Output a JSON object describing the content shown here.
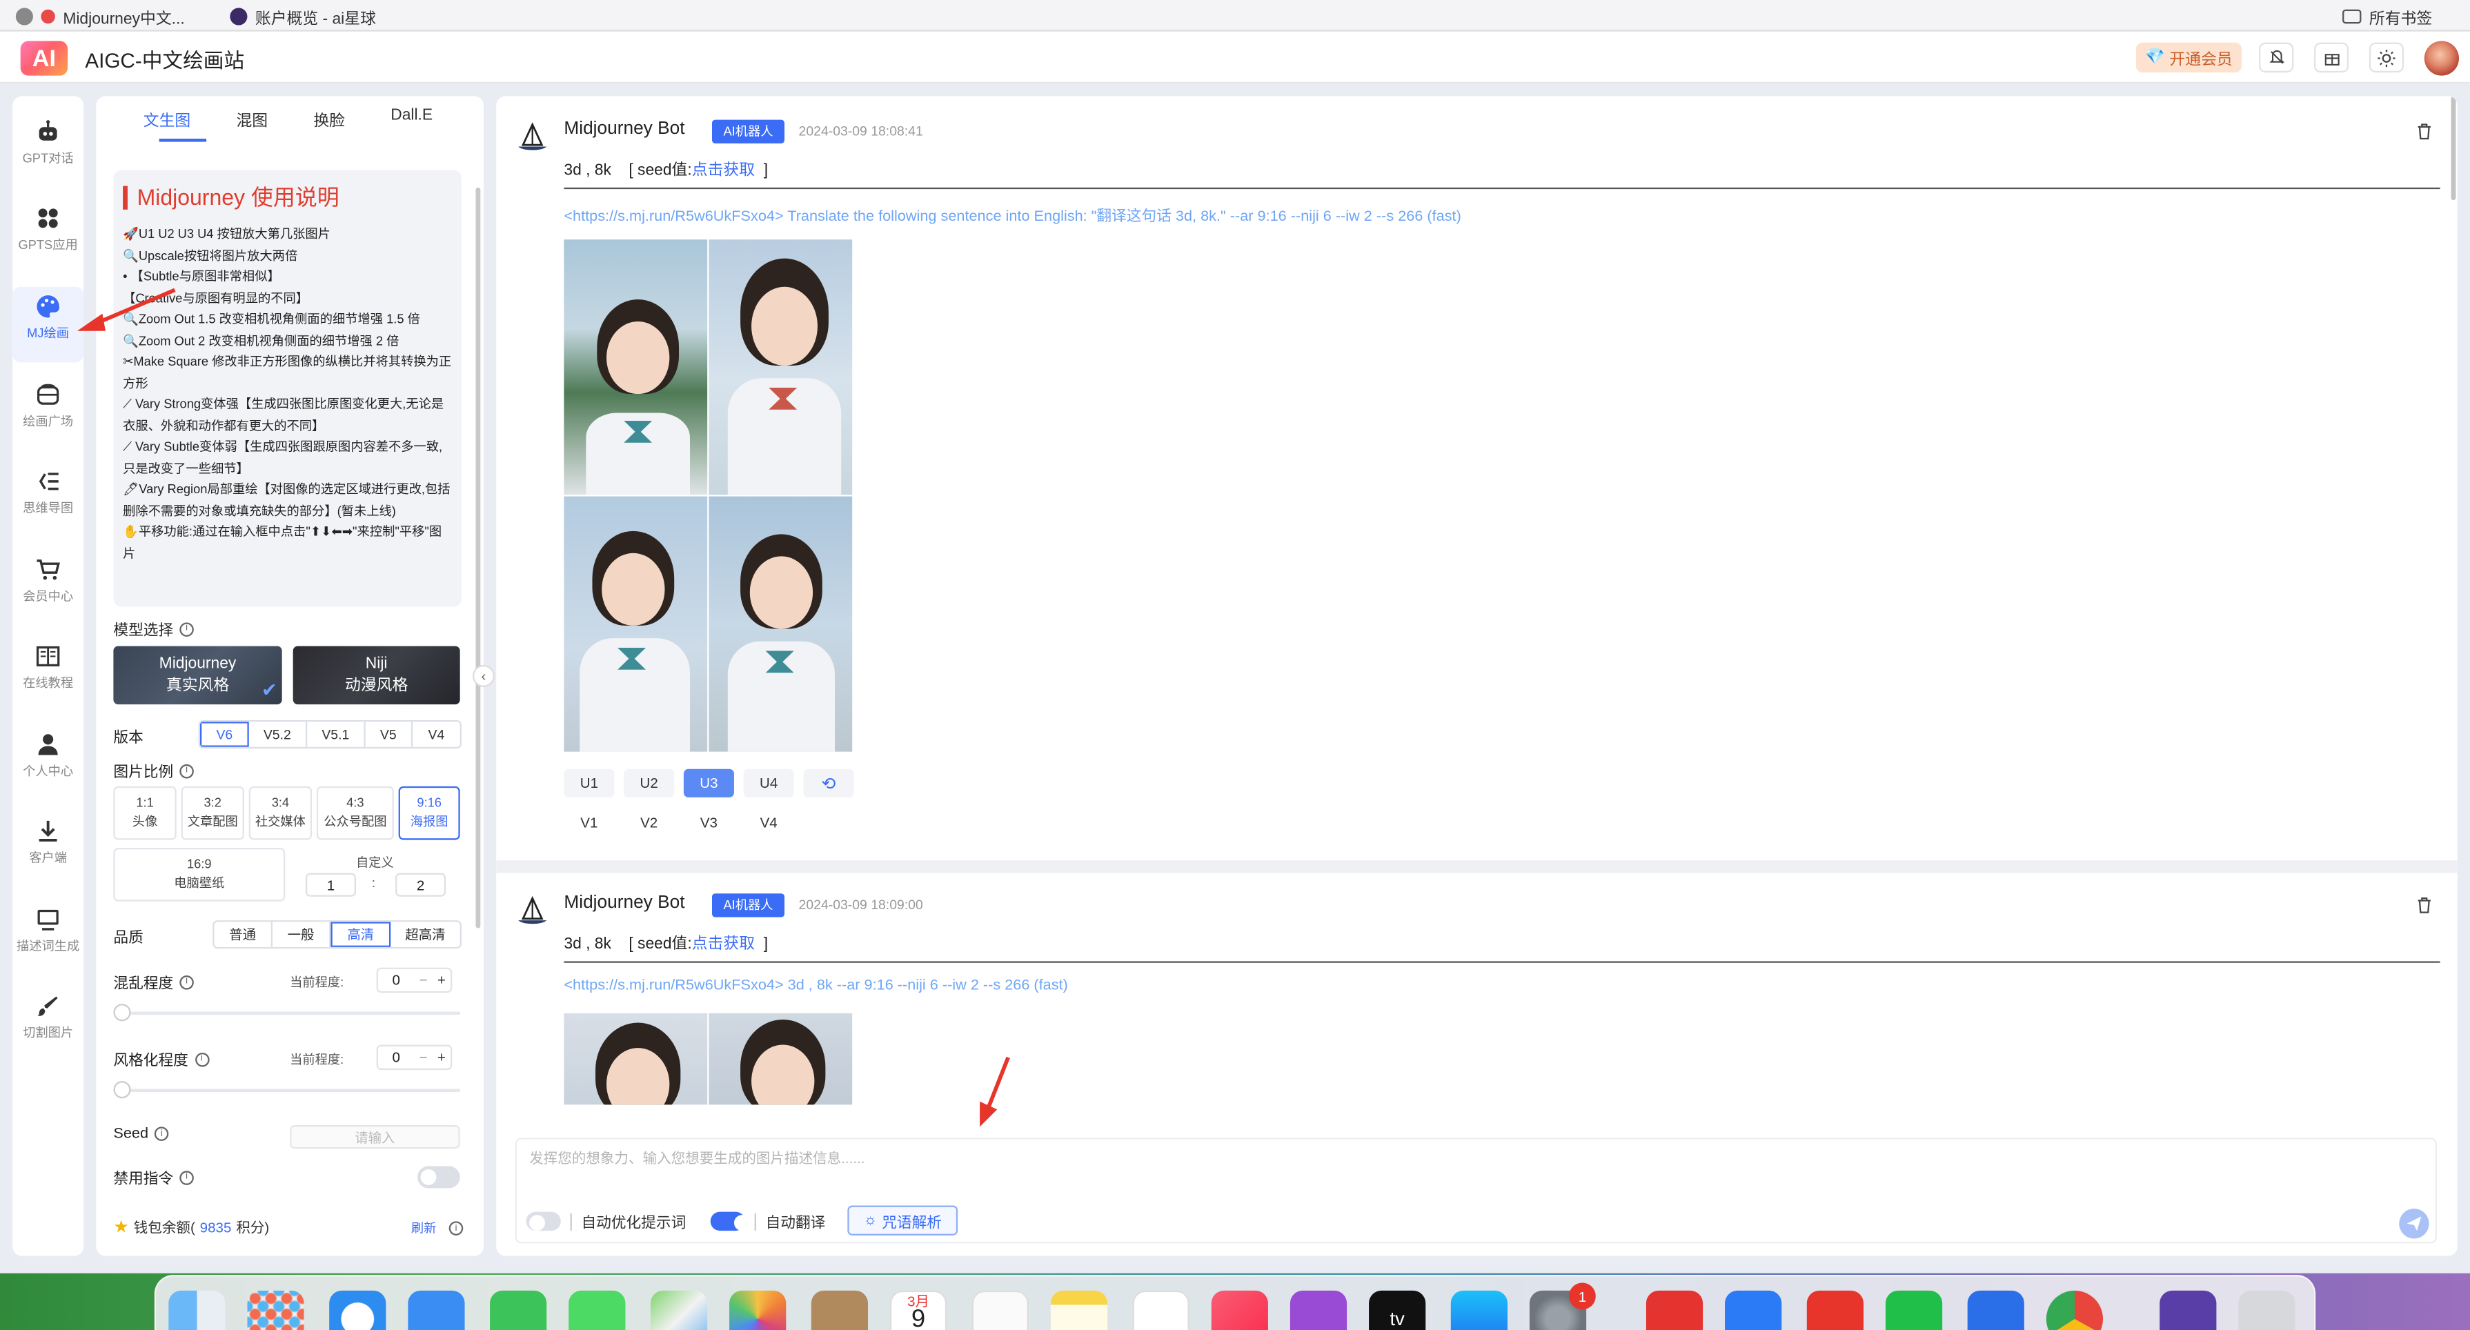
{
  "browser": {
    "tabs": [
      {
        "label": "Midjourney中文..."
      },
      {
        "label": "账户概览 - ai星球"
      }
    ],
    "bookmarks_label": "所有书签"
  },
  "header": {
    "logo": "AI",
    "title": "AIGC-中文绘画站",
    "vip_label": "开通会员"
  },
  "sidebar": {
    "items": [
      {
        "label": "GPT对话",
        "icon": "robot-icon"
      },
      {
        "label": "GPTS应用",
        "icon": "apps-icon"
      },
      {
        "label": "MJ绘画",
        "icon": "palette-icon",
        "active": true
      },
      {
        "label": "绘画广场",
        "icon": "gallery-icon"
      },
      {
        "label": "思维导图",
        "icon": "mindmap-icon"
      },
      {
        "label": "会员中心",
        "icon": "cart-icon"
      },
      {
        "label": "在线教程",
        "icon": "book-icon"
      },
      {
        "label": "个人中心",
        "icon": "user-icon"
      },
      {
        "label": "客户端",
        "icon": "download-icon"
      },
      {
        "label": "描述词生成",
        "icon": "monitor-icon"
      },
      {
        "label": "切割图片",
        "icon": "brush-icon"
      }
    ]
  },
  "panel": {
    "tabs": [
      "文生图",
      "混图",
      "换脸",
      "Dall.E"
    ],
    "guide": {
      "title": "Midjourney 使用说明",
      "lines": [
        "🚀U1 U2 U3 U4 按钮放大第几张图片",
        "🔍Upscale按钮将图片放大两倍",
        "• 【Subtle与原图非常相似】",
        "  【Creative与原图有明显的不同】",
        "🔍Zoom Out 1.5 改变相机视角侧面的细节增强 1.5 倍",
        "🔍Zoom Out 2 改变相机视角侧面的细节增强 2 倍",
        "✂Make Square 修改非正方形图像的纵横比并将其转换为正方形",
        "⟋ Vary Strong变体强【生成四张图比原图变化更大,无论是衣服、外貌和动作都有更大的不同】",
        "⟋ Vary Subtle变体弱【生成四张图跟原图内容差不多一致,只是改变了一些细节】",
        "🖊Vary Region局部重绘【对图像的选定区域进行更改,包括删除不需要的对象或填充缺失的部分】(暂未上线)",
        "✋平移功能:通过在输入框中点击\"⬆⬇⬅➡\"来控制\"平移\"图片"
      ]
    },
    "model_label": "模型选择",
    "models": [
      {
        "name": "Midjourney",
        "sub": "真实风格"
      },
      {
        "name": "Niji",
        "sub": "动漫风格"
      }
    ],
    "version_label": "版本",
    "versions": [
      "V6",
      "V5.2",
      "V5.1",
      "V5",
      "V4"
    ],
    "ratio_label": "图片比例",
    "ratios": [
      {
        "r": "1:1",
        "d": "头像"
      },
      {
        "r": "3:2",
        "d": "文章配图"
      },
      {
        "r": "3:4",
        "d": "社交媒体"
      },
      {
        "r": "4:3",
        "d": "公众号配图"
      },
      {
        "r": "9:16",
        "d": "海报图"
      }
    ],
    "ratio_wide": {
      "r": "16:9",
      "d": "电脑壁纸"
    },
    "custom_label": "自定义",
    "custom_w": "1",
    "custom_colon": ":",
    "custom_h": "2",
    "quality_label": "品质",
    "qualities": [
      "普通",
      "一般",
      "高清",
      "超高清"
    ],
    "chaos_label": "混乱程度",
    "stylize_label": "风格化程度",
    "current_label": "当前程度:",
    "chaos_value": "0",
    "stylize_value": "0",
    "seed_label": "Seed",
    "seed_placeholder": "请输入",
    "noprompt_label": "禁用指令",
    "wallet_prefix": "钱包余额(",
    "wallet_value": "9835",
    "wallet_suffix": "积分)",
    "refresh_label": "刷新"
  },
  "messages": [
    {
      "bot": "Midjourney Bot",
      "badge": "AI机器人",
      "time": "2024-03-09 18:08:41",
      "prompt": "3d , 8k",
      "seed_prefix": "[ seed值:",
      "seed_link": "点击获取",
      "seed_suffix": "]",
      "link": "<https://s.mj.run/R5w6UkFSxo4> Translate the following sentence into English: \"翻译这句话 3d, 8k.\" --ar 9:16 --niji 6 --iw 2 --s 266 (fast)",
      "u_buttons": [
        "U1",
        "U2",
        "U3",
        "U4"
      ],
      "v_buttons": [
        "V1",
        "V2",
        "V3",
        "V4"
      ]
    },
    {
      "bot": "Midjourney Bot",
      "badge": "AI机器人",
      "time": "2024-03-09 18:09:00",
      "prompt": "3d , 8k",
      "seed_prefix": "[ seed值:",
      "seed_link": "点击获取",
      "seed_suffix": "]",
      "link": "<https://s.mj.run/R5w6UkFSxo4> 3d , 8k --ar 9:16 --niji 6 --iw 2 --s 266 (fast)"
    }
  ],
  "input": {
    "placeholder": "发挥您的想象力、输入您想要生成的图片描述信息......",
    "auto_optimize": "自动优化提示词",
    "auto_translate": "自动翻译",
    "spell_label": "咒语解析"
  },
  "dock": {
    "badge": "1",
    "calendar_month": "3月",
    "calendar_day": "9",
    "tv_label": "tv"
  },
  "colors": {
    "accent": "#3b6cf5",
    "title_red": "#e03c2f",
    "arrow_red": "#e8352c"
  }
}
